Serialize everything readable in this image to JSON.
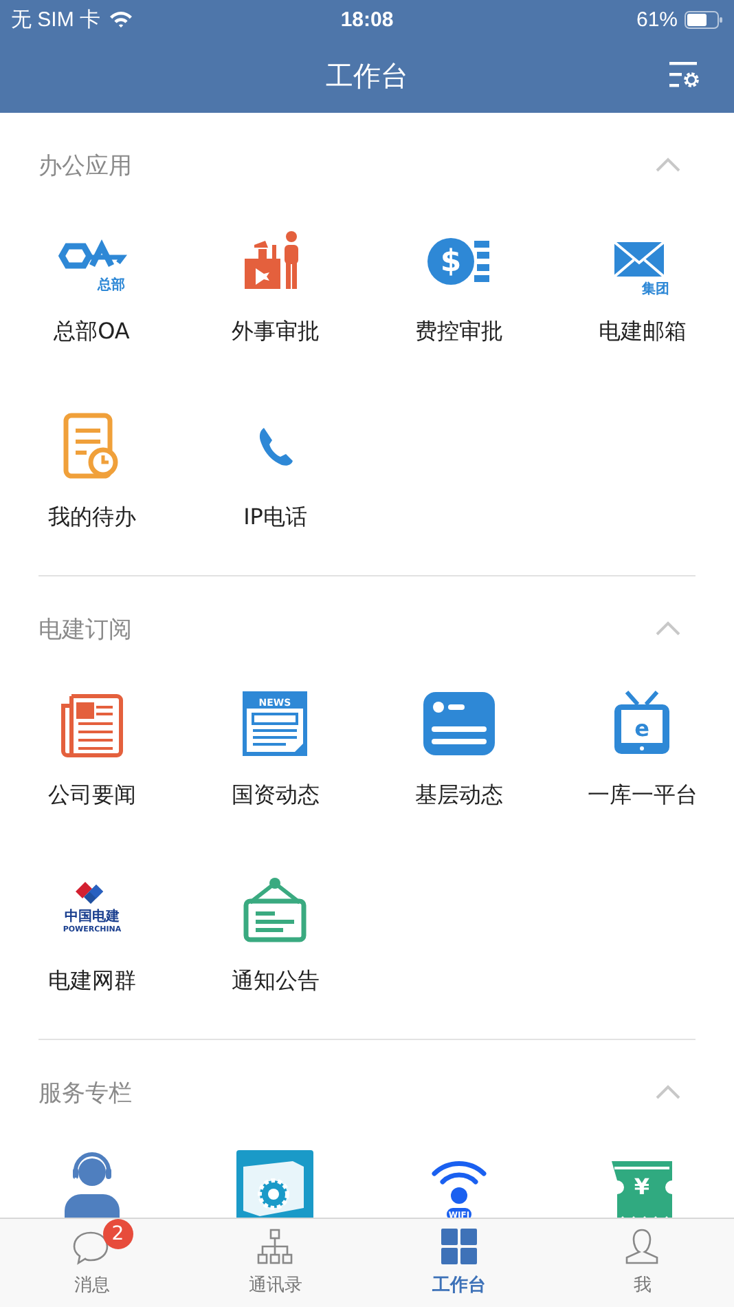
{
  "status_bar": {
    "carrier": "无 SIM 卡",
    "time": "18:08",
    "battery": "61%"
  },
  "header": {
    "title": "工作台"
  },
  "sections": [
    {
      "title": "办公应用",
      "expanded": true,
      "items": [
        {
          "kind": "oa",
          "label": "总部OA",
          "icon_text": [
            "总部"
          ]
        },
        {
          "kind": "visa",
          "label": "外事审批"
        },
        {
          "kind": "money",
          "label": "费控审批",
          "icon_text": [
            "$"
          ]
        },
        {
          "kind": "mail",
          "label": "电建邮箱",
          "icon_text": [
            "集团"
          ]
        },
        {
          "kind": "todo",
          "label": "我的待办"
        },
        {
          "kind": "phone",
          "label": "IP电话"
        }
      ]
    },
    {
      "title": "电建订阅",
      "expanded": true,
      "items": [
        {
          "kind": "newspaper",
          "label": "公司要闻"
        },
        {
          "kind": "news",
          "label": "国资动态",
          "icon_text": [
            "NEWS"
          ]
        },
        {
          "kind": "card",
          "label": "基层动态"
        },
        {
          "kind": "tv",
          "label": "一库一平台",
          "icon_text": [
            "e"
          ]
        },
        {
          "kind": "powerchina",
          "label": "电建网群",
          "icon_text": [
            "中国电建",
            "POWERCHINA"
          ]
        },
        {
          "kind": "notice",
          "label": "通知公告"
        }
      ]
    },
    {
      "title": "服务专栏",
      "expanded": true,
      "items": [
        {
          "kind": "support"
        },
        {
          "kind": "gear"
        },
        {
          "kind": "wifi",
          "icon_text": [
            "WIFI"
          ]
        },
        {
          "kind": "ticket",
          "icon_text": [
            "¥"
          ]
        }
      ]
    }
  ],
  "tabs": [
    {
      "kind": "chat",
      "label": "消息",
      "selected": false,
      "badge": "2"
    },
    {
      "kind": "org",
      "label": "通讯录",
      "selected": false
    },
    {
      "kind": "grid",
      "label": "工作台",
      "selected": true
    },
    {
      "kind": "person",
      "label": "我",
      "selected": false
    }
  ]
}
